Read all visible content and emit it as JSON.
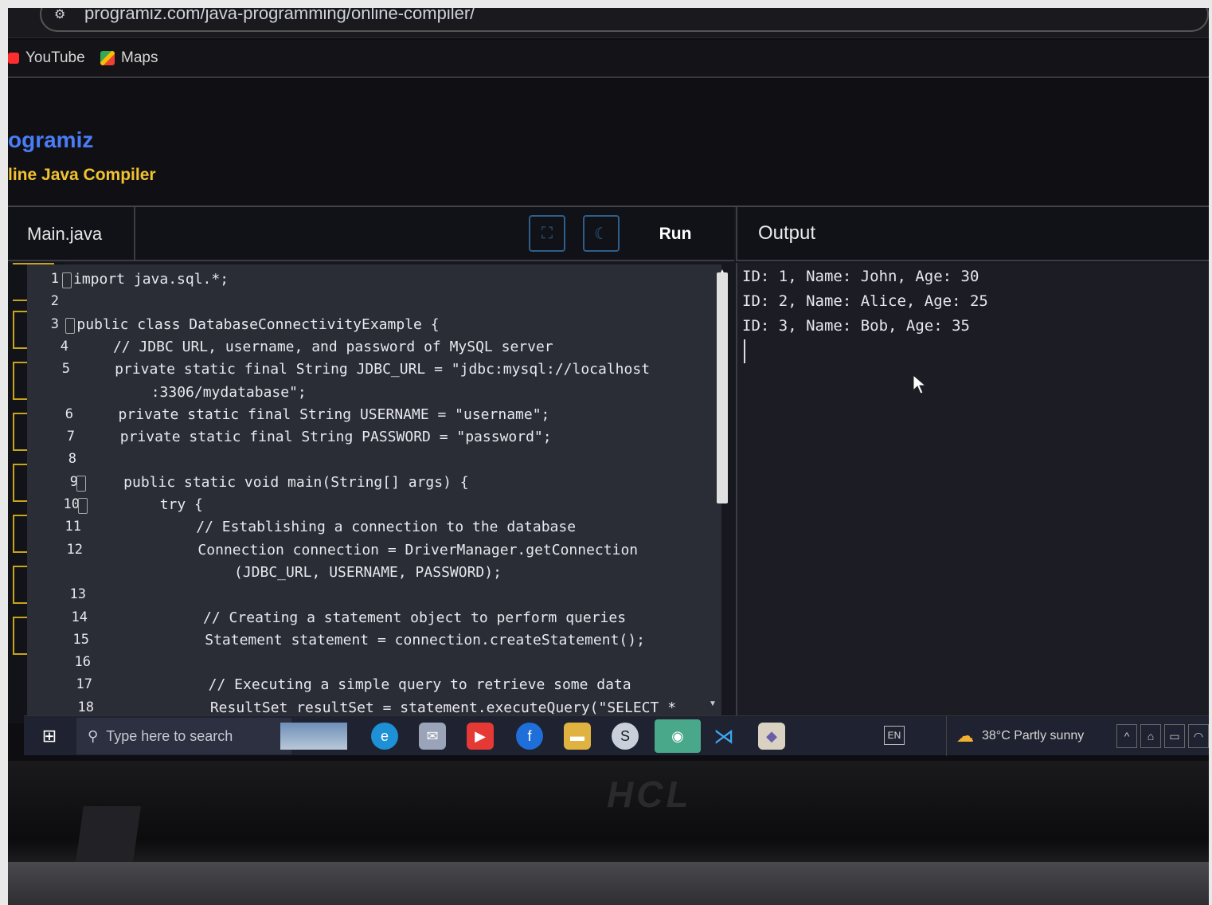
{
  "browser": {
    "url": "programiz.com/java-programming/online-compiler/",
    "bookmarks": [
      "YouTube",
      "Maps"
    ]
  },
  "site": {
    "brand": "ogramiz",
    "subtitle": "line Java Compiler"
  },
  "toolbar": {
    "file_tab": "Main.java",
    "run_label": "Run",
    "output_label": "Output"
  },
  "editor": {
    "lines": [
      {
        "n": "1",
        "text": "import java.sql.*;",
        "fold": true
      },
      {
        "n": "2",
        "text": ""
      },
      {
        "n": "3",
        "text": "public class DatabaseConnectivityExample {",
        "fold": true
      },
      {
        "n": "4",
        "text": "    // JDBC URL, username, and password of MySQL server"
      },
      {
        "n": "5",
        "text": "    private static final String JDBC_URL = \"jdbc:mysql://localhost"
      },
      {
        "n": "",
        "text": "        :3306/mydatabase\";"
      },
      {
        "n": "6",
        "text": "    private static final String USERNAME = \"username\";"
      },
      {
        "n": "7",
        "text": "    private static final String PASSWORD = \"password\";"
      },
      {
        "n": "8",
        "text": ""
      },
      {
        "n": "9",
        "text": "    public static void main(String[] args) {",
        "fold": true
      },
      {
        "n": "10",
        "text": "        try {",
        "fold": true
      },
      {
        "n": "11",
        "text": "            // Establishing a connection to the database"
      },
      {
        "n": "12",
        "text": "            Connection connection = DriverManager.getConnection"
      },
      {
        "n": "",
        "text": "                (JDBC_URL, USERNAME, PASSWORD);"
      },
      {
        "n": "13",
        "text": ""
      },
      {
        "n": "14",
        "text": "            // Creating a statement object to perform queries"
      },
      {
        "n": "15",
        "text": "            Statement statement = connection.createStatement();"
      },
      {
        "n": "16",
        "text": ""
      },
      {
        "n": "17",
        "text": "            // Executing a simple query to retrieve some data"
      },
      {
        "n": "18",
        "text": "            ResultSet resultSet = statement.executeQuery(\"SELECT *"
      }
    ]
  },
  "output": {
    "lines": [
      "ID: 1, Name: John, Age: 30",
      "ID: 2, Name: Alice, Age: 25",
      "ID: 3, Name: Bob, Age: 35"
    ]
  },
  "taskbar": {
    "search_placeholder": "Type here to search",
    "language": "EN",
    "weather": "38°C  Partly sunny",
    "apps": [
      "edge-icon",
      "mail-icon",
      "youtube-icon",
      "facebook-icon",
      "file-explorer-icon",
      "skype-icon",
      "chrome-icon",
      "vscode-icon",
      "app-icon"
    ]
  },
  "laptop": {
    "brand": "HCL"
  },
  "colors": {
    "brand_blue": "#4a7cf7",
    "brand_yellow": "#f2c230",
    "editor_bg": "#2a2c36",
    "output_bg": "#1c1d24"
  }
}
